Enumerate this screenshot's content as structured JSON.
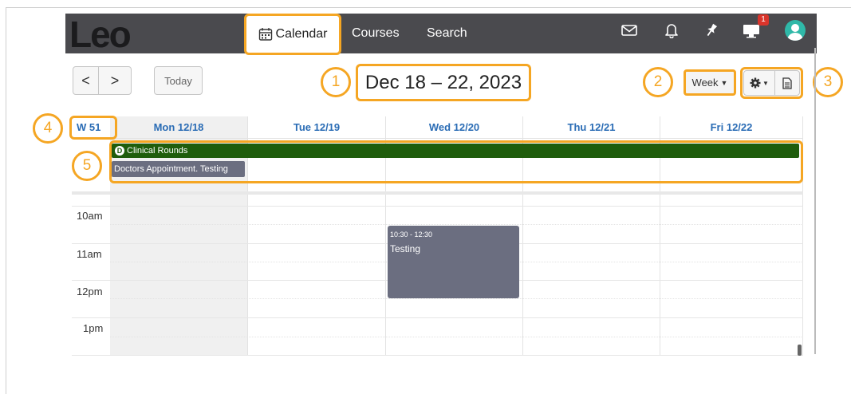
{
  "app": {
    "logo": "Leo",
    "nav": [
      {
        "label": "Calendar",
        "icon": "calendar-icon"
      },
      {
        "label": "Courses"
      },
      {
        "label": "Search"
      }
    ],
    "icons": [
      "mail-icon",
      "bell-icon",
      "pin-icon",
      "monitor-icon",
      "avatar"
    ],
    "notification_count": "1"
  },
  "toolbar": {
    "prev_icon": "chevron-left-icon",
    "next_icon": "chevron-right-icon",
    "prev_label": "<",
    "next_label": ">",
    "today_label": "Today",
    "date_range": "Dec 18 – 22, 2023",
    "view_label": "Week",
    "settings_icon": "gear-icon",
    "print_icon": "document-icon"
  },
  "calendar": {
    "week_label": "W 51",
    "days": [
      "Mon 12/18",
      "Tue 12/19",
      "Wed 12/20",
      "Thu 12/21",
      "Fri 12/22"
    ],
    "times": [
      "10am",
      "11am",
      "12pm",
      "1pm"
    ],
    "allday_events": [
      {
        "badge": "D",
        "title": "Clinical Rounds"
      },
      {
        "title": "Doctors Appointment. Testing"
      }
    ],
    "events": [
      {
        "time": "10:30 - 12:30",
        "title": "Testing"
      }
    ]
  },
  "callouts": [
    "1",
    "2",
    "3",
    "4",
    "5"
  ],
  "colors": {
    "accent": "#f5a623",
    "topbar": "#4a4a4e",
    "link_blue": "#2a6cb5",
    "clinical_green": "#1f5d0c",
    "event_gray": "#6b6e80"
  }
}
